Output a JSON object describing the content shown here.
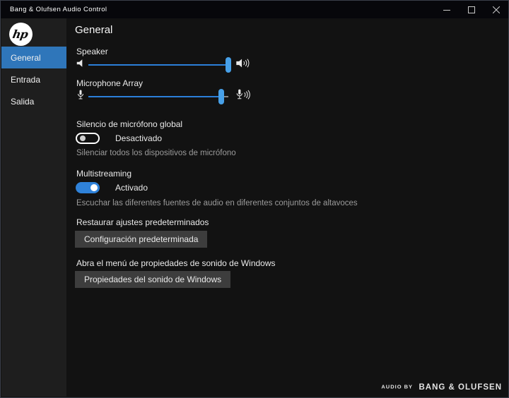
{
  "window_title": "Bang & Olufsen Audio Control",
  "window_controls": {
    "minimize": "minimize",
    "maximize": "maximize",
    "close": "close"
  },
  "sidebar": {
    "logo": "hp",
    "items": [
      {
        "label": "General",
        "selected": true
      },
      {
        "label": "Entrada",
        "selected": false
      },
      {
        "label": "Salida",
        "selected": false
      }
    ]
  },
  "main": {
    "heading": "General",
    "speaker": {
      "label": "Speaker",
      "value": 100
    },
    "microphone": {
      "label": "Microphone Array",
      "value": 95
    },
    "mute": {
      "title": "Silencio de micrófono global",
      "state_label": "Desactivado",
      "enabled": false,
      "description": "Silenciar todos los dispositivos de micrófono"
    },
    "multistreaming": {
      "title": "Multistreaming",
      "state_label": "Activado",
      "enabled": true,
      "description": "Escuchar las diferentes fuentes de audio en diferentes conjuntos de altavoces"
    },
    "restore": {
      "title": "Restaurar ajustes predeterminados",
      "button_label": "Configuración predeterminada"
    },
    "windows_sound": {
      "title": "Abra el menú de propiedades de sonido de Windows",
      "button_label": "Propiedades del sonido de Windows"
    }
  },
  "footer": {
    "audio_by": "AUDIO BY",
    "brand": "BANG & OLUFSEN"
  },
  "colors": {
    "accent_sidebar_selected": "#2f76ba",
    "slider_fill": "#2b7fd9",
    "slider_thumb": "#47a0e8",
    "toggle_on": "#2f82d9",
    "button_bg": "#3d3d3d",
    "titlebar_bg": "#07070b",
    "sidebar_bg": "#1e1e1e",
    "main_bg": "#121212"
  }
}
